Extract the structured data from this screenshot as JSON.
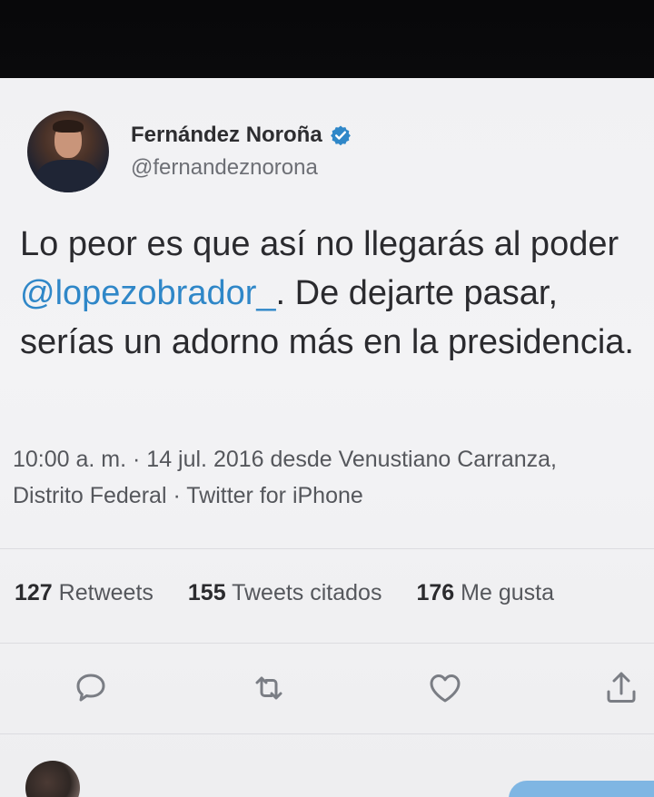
{
  "tweet": {
    "author": {
      "display_name": "Fernández Noroña",
      "handle": "@fernandeznorona",
      "verified": true
    },
    "text": {
      "part1": "Lo peor es que así no llegarás al poder ",
      "mention": "@lopezobrador_",
      "part2": ". De dejarte pasar, serías un adorno más en la presidencia."
    },
    "meta": {
      "line1": "10:00 a. m. · 14 jul. 2016 desde Venustiano Carranza,",
      "line2": "Distrito Federal · Twitter for iPhone"
    },
    "stats": {
      "retweets_count": "127",
      "retweets_label": "Retweets",
      "quotes_count": "155",
      "quotes_label": "Tweets citados",
      "likes_count": "176",
      "likes_label": "Me gusta"
    },
    "actions": {
      "reply_icon": "reply-icon",
      "retweet_icon": "retweet-icon",
      "like_icon": "heart-icon",
      "share_icon": "share-icon"
    }
  },
  "colors": {
    "accent": "#2f87c8",
    "text_primary": "#2a2a2e",
    "text_secondary": "#55575c",
    "icon": "#7a7d84"
  }
}
